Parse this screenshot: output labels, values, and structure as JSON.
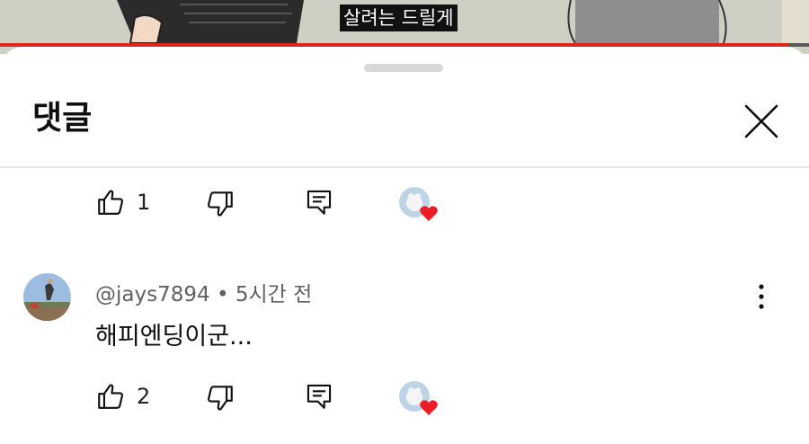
{
  "video": {
    "caption": "살려는 드릴게",
    "progress": 0.975,
    "accent_color": "#e0251b"
  },
  "comments_panel": {
    "title": "댓글",
    "close_icon": "close-icon"
  },
  "previous_comment": {
    "like_count": "1",
    "icons": [
      "thumb-up-icon",
      "thumb-down-icon",
      "reply-icon",
      "creator-heart-icon"
    ]
  },
  "comment": {
    "author": "@jays7894",
    "separator": "•",
    "time": "5시간 전",
    "text": "해피엔딩이군...",
    "like_count": "2",
    "icons": [
      "thumb-up-icon",
      "thumb-down-icon",
      "reply-icon",
      "creator-heart-icon",
      "more-vert-icon"
    ]
  }
}
